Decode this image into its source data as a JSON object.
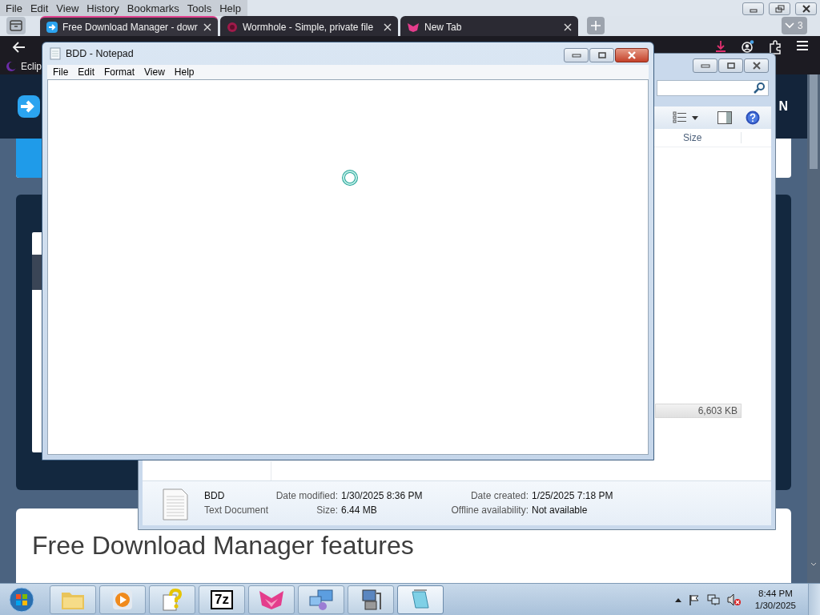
{
  "browser": {
    "menu": [
      "File",
      "Edit",
      "View",
      "History",
      "Bookmarks",
      "Tools",
      "Help"
    ],
    "tabs": [
      {
        "title": "Free Download Manager - dowr",
        "selected": true
      },
      {
        "title": "Wormhole - Simple, private file",
        "selected": false
      },
      {
        "title": "New Tab",
        "selected": false
      }
    ],
    "tab_count": "3",
    "bookmarks": [
      "Eclip"
    ],
    "page": {
      "header_text": "N",
      "heading": "Free Download Manager features"
    }
  },
  "explorer": {
    "columns": [
      "Size"
    ],
    "rows": [
      {
        "size": "6,603 KB",
        "selected": true
      }
    ],
    "details": {
      "name": "BDD",
      "type": "Text Document",
      "fields": [
        {
          "label": "Date modified:",
          "value": "1/30/2025 8:36 PM"
        },
        {
          "label": "Date created:",
          "value": "1/25/2025 7:18 PM"
        },
        {
          "label": "Size:",
          "value": "6.44 MB"
        },
        {
          "label": "Offline availability:",
          "value": "Not available"
        }
      ]
    }
  },
  "notepad": {
    "title": "BDD - Notepad",
    "menu": [
      "File",
      "Edit",
      "Format",
      "View",
      "Help"
    ]
  },
  "taskbar": {
    "apps": [
      {
        "kind": "folder",
        "selected": false
      },
      {
        "kind": "media",
        "selected": false
      },
      {
        "kind": "help",
        "selected": false
      },
      {
        "kind": "archive",
        "label": "7z",
        "selected": false
      },
      {
        "kind": "fox",
        "selected": false
      },
      {
        "kind": "network",
        "selected": false
      },
      {
        "kind": "computer",
        "selected": false
      },
      {
        "kind": "notepad",
        "selected": true
      }
    ],
    "clock": {
      "time": "8:44 PM",
      "date": "1/30/2025"
    }
  }
}
